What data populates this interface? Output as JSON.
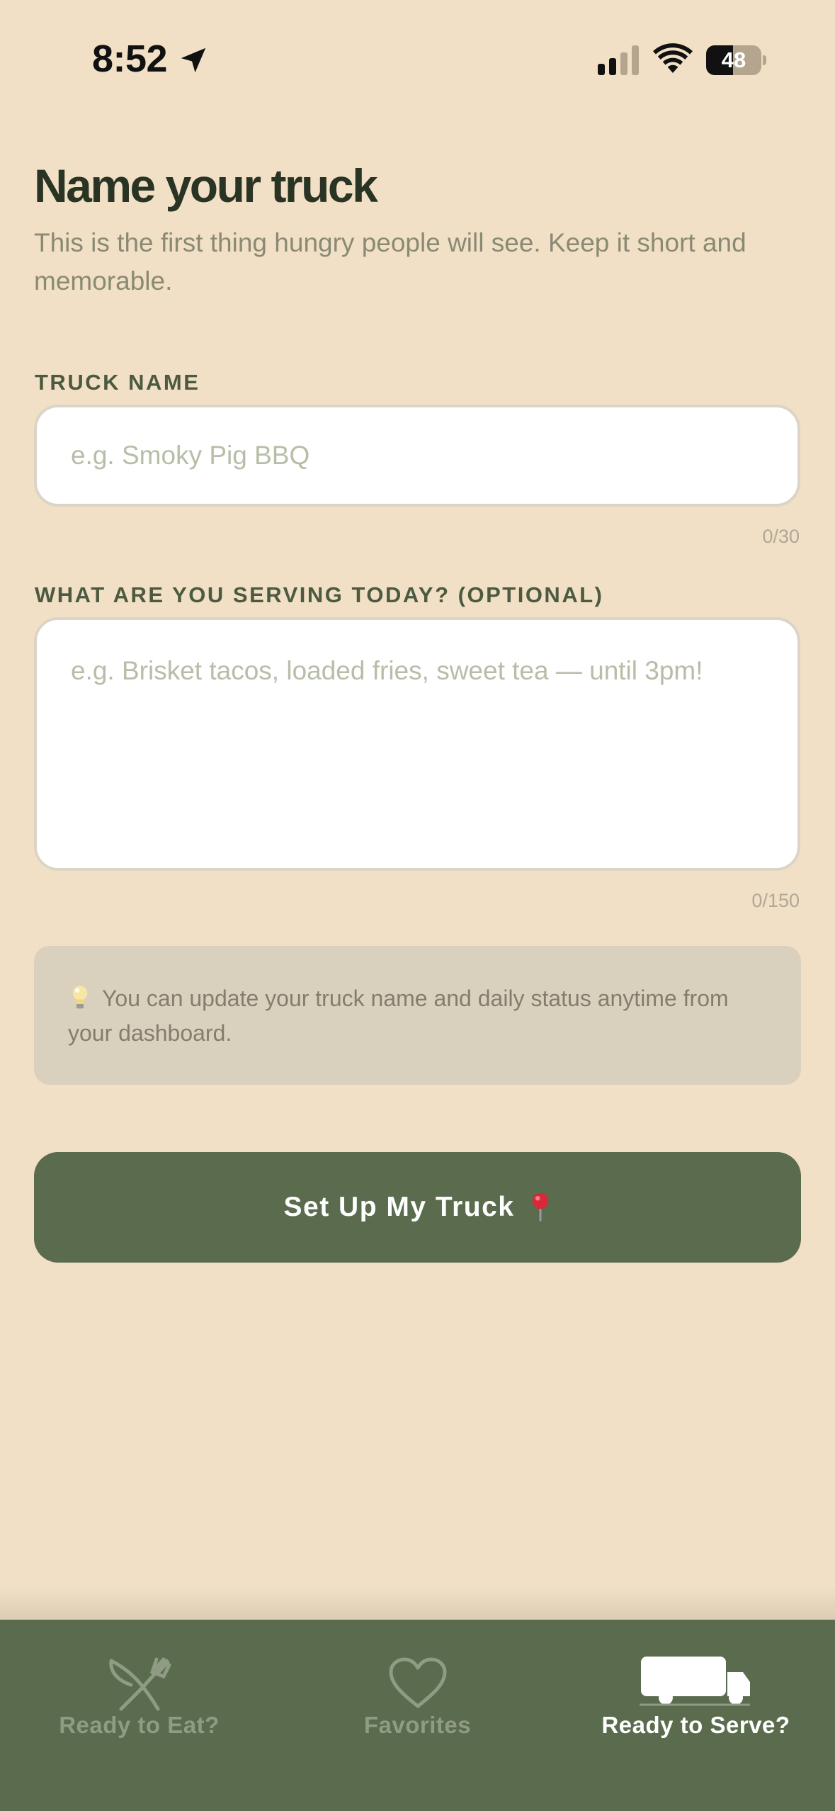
{
  "status_bar": {
    "time": "8:52",
    "battery": "48"
  },
  "header": {
    "title": "Name your truck",
    "subtitle": "This is the first thing hungry people will see. Keep it short and memorable."
  },
  "form": {
    "truck_name": {
      "label": "TRUCK NAME",
      "value": "",
      "placeholder": "e.g. Smoky Pig BBQ",
      "counter": "0/30"
    },
    "serving": {
      "label": "WHAT ARE YOU SERVING TODAY? (OPTIONAL)",
      "value": "",
      "placeholder": "e.g. Brisket tacos, loaded fries, sweet tea — until 3pm!",
      "counter": "0/150"
    }
  },
  "tip": {
    "icon": "lightbulb-icon",
    "text": "You can update your truck name and daily status anytime from your dashboard."
  },
  "cta": {
    "label": "Set Up My Truck",
    "icon": "pin-icon"
  },
  "tab_bar": {
    "active": "Ready to Serve?",
    "tabs": [
      {
        "label": "Ready to Eat?",
        "icon": "utensils-crossed-icon"
      },
      {
        "label": "Favorites",
        "icon": "heart-icon"
      },
      {
        "label": "Ready to Serve?",
        "icon": "truck-icon"
      }
    ]
  },
  "colors": {
    "background": "#F1E0C5",
    "primary": "#5A6B4E",
    "title": "#2A3424",
    "tip_background": "#DAD0BE"
  }
}
